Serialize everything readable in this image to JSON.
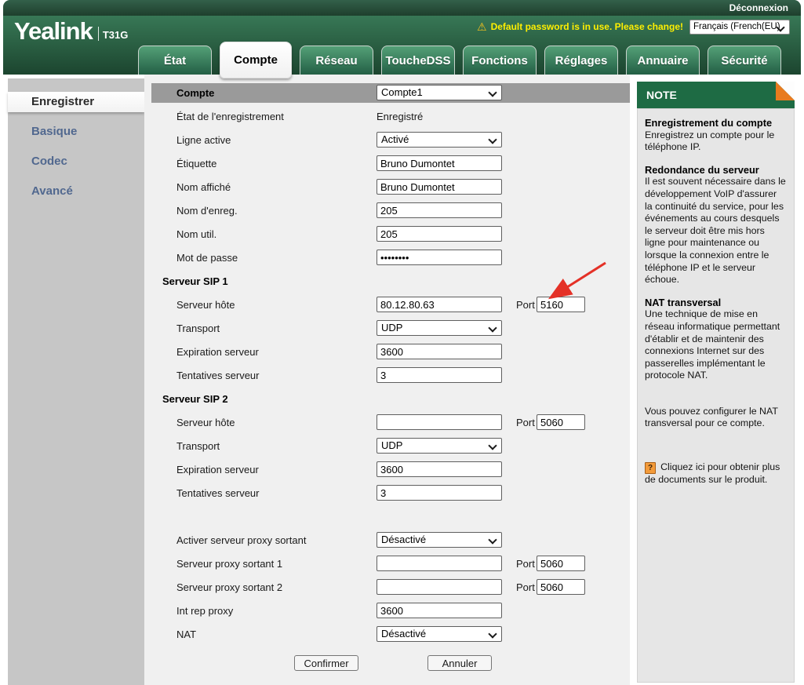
{
  "topbar": {
    "logout": "Déconnexion"
  },
  "header": {
    "brand": "Yealink",
    "model": "T31G",
    "warning_icon": "⚠",
    "warning": "Default password is in use. Please change!",
    "language": "Français (French(EU)",
    "tabs": [
      {
        "label": "État",
        "active": false
      },
      {
        "label": "Compte",
        "active": true
      },
      {
        "label": "Réseau",
        "active": false
      },
      {
        "label": "ToucheDSS",
        "active": false
      },
      {
        "label": "Fonctions",
        "active": false
      },
      {
        "label": "Réglages",
        "active": false
      },
      {
        "label": "Annuaire",
        "active": false
      },
      {
        "label": "Sécurité",
        "active": false
      }
    ]
  },
  "sidebar": {
    "items": [
      {
        "label": "Enregistrer",
        "active": true
      },
      {
        "label": "Basique",
        "active": false
      },
      {
        "label": "Codec",
        "active": false
      },
      {
        "label": "Avancé",
        "active": false
      }
    ]
  },
  "form": {
    "port_label": "Port",
    "account_row": {
      "label": "Compte",
      "value": "Compte1"
    },
    "rows": [
      {
        "label": "État de l'enregistrement",
        "type": "static",
        "value": "Enregistré"
      },
      {
        "label": "Ligne active",
        "type": "select",
        "value": "Activé"
      },
      {
        "label": "Étiquette",
        "type": "input",
        "value": "Bruno Dumontet"
      },
      {
        "label": "Nom affiché",
        "type": "input",
        "value": "Bruno Dumontet"
      },
      {
        "label": "Nom d'enreg.",
        "type": "input",
        "value": "205"
      },
      {
        "label": "Nom util.",
        "type": "input",
        "value": "205"
      },
      {
        "label": "Mot de passe",
        "type": "password",
        "value": "********"
      },
      {
        "label": "Serveur SIP 1",
        "type": "section"
      },
      {
        "label": "Serveur hôte",
        "type": "input",
        "value": "80.12.80.63",
        "port": "5160"
      },
      {
        "label": "Transport",
        "type": "select",
        "value": "UDP"
      },
      {
        "label": "Expiration serveur",
        "type": "input",
        "value": "3600"
      },
      {
        "label": "Tentatives serveur",
        "type": "input",
        "value": "3"
      },
      {
        "label": "Serveur SIP 2",
        "type": "section"
      },
      {
        "label": "Serveur hôte",
        "type": "input",
        "value": "",
        "port": "5060"
      },
      {
        "label": "Transport",
        "type": "select",
        "value": "UDP"
      },
      {
        "label": "Expiration serveur",
        "type": "input",
        "value": "3600"
      },
      {
        "label": "Tentatives serveur",
        "type": "input",
        "value": "3"
      },
      {
        "label": "",
        "type": "spacer"
      },
      {
        "label": "Activer serveur proxy sortant",
        "type": "select",
        "value": "Désactivé"
      },
      {
        "label": "Serveur proxy sortant 1",
        "type": "input",
        "value": "",
        "port": "5060"
      },
      {
        "label": "Serveur proxy sortant 2",
        "type": "input",
        "value": "",
        "port": "5060"
      },
      {
        "label": "Int rep proxy",
        "type": "input",
        "value": "3600"
      },
      {
        "label": "NAT",
        "type": "select",
        "value": "Désactivé"
      }
    ],
    "buttons": {
      "confirm": "Confirmer",
      "cancel": "Annuler"
    }
  },
  "note": {
    "title": "NOTE",
    "help_icon": "?",
    "sections": [
      {
        "heading": "Enregistrement du compte",
        "body": "Enregistrez un compte pour le téléphone IP."
      },
      {
        "heading": "Redondance du serveur",
        "body": "Il est souvent nécessaire dans le développement VoIP d'assurer la continuité du service, pour les événements au cours desquels le serveur doit être mis hors ligne pour maintenance ou lorsque la connexion entre le téléphone IP et le serveur échoue."
      },
      {
        "heading": "NAT transversal",
        "body": "Une technique de mise en réseau informatique permettant d'établir et de maintenir des connexions Internet sur des passerelles implémentant le protocole NAT."
      }
    ],
    "extra": "Vous pouvez configurer le NAT transversal pour ce compte.",
    "tip": "Cliquez ici pour obtenir plus de documents sur le produit."
  },
  "colors": {
    "header_green_top": "#3f8560",
    "header_green_bottom": "#1c452f",
    "tab_green": "#2f7251",
    "note_green": "#1e6b44",
    "fold_orange": "#e87b1e",
    "warning_yellow": "#ffef00",
    "sidebar_link": "#51688f",
    "band_gray": "#9a9a9a",
    "arrow_red": "#e43127"
  }
}
